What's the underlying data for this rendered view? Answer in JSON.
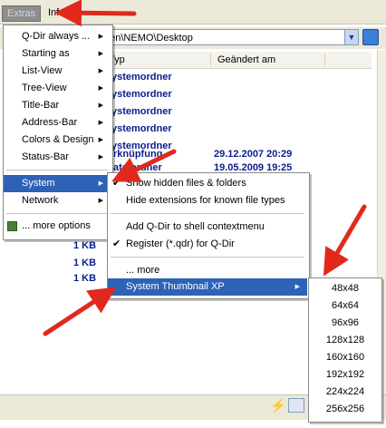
{
  "menubar": {
    "extras_label": "Extras",
    "info_label": "Info"
  },
  "address": {
    "value": "gen\\NEMO\\Desktop"
  },
  "columns": {
    "type": "Typ",
    "changed": "Geändert am"
  },
  "file_rows": {
    "types": [
      "ystemordner",
      "ystemordner",
      "ystemordner",
      "ystemordner",
      "ystemordner",
      "rknüpfung",
      "ateiordner"
    ],
    "dates": [
      "29.12.2007 20:29",
      "19.05.2009 19:25"
    ],
    "sizes": [
      "1 KB",
      "1 KB",
      "1 KB"
    ]
  },
  "extras_menu": {
    "items": [
      {
        "label": "Q-Dir always ..."
      },
      {
        "label": "Starting as"
      },
      {
        "label": "List-View"
      },
      {
        "label": "Tree-View"
      },
      {
        "label": "Title-Bar"
      },
      {
        "label": "Address-Bar"
      },
      {
        "label": "Colors & Design"
      },
      {
        "label": "Status-Bar"
      },
      {
        "label": "System"
      },
      {
        "label": "Network"
      },
      {
        "label": "... more options"
      }
    ]
  },
  "system_menu": {
    "items": [
      {
        "label": "Show hidden files & folders",
        "checked": true
      },
      {
        "label": "Hide extensions for known file types",
        "checked": false
      },
      {
        "label": "Add Q-Dir to shell contextmenu",
        "checked": false
      },
      {
        "label": "Register (*.qdr) for Q-Dir",
        "checked": true
      },
      {
        "label": "... more",
        "checked": false
      },
      {
        "label": "System Thumbnail XP",
        "checked": false
      }
    ]
  },
  "thumbnail_menu": {
    "items": [
      "48x48",
      "64x64",
      "96x96",
      "128x128",
      "160x160",
      "192x192",
      "224x224",
      "256x256"
    ]
  },
  "icons": {
    "checkmark": "✔",
    "submenu_arrow": "▶",
    "dropdown": "▼",
    "status_flash": "⚡"
  },
  "colors": {
    "highlight": "#2d62b6",
    "file_text": "#0b1c8f",
    "annotation_arrows": "#e0291c"
  }
}
